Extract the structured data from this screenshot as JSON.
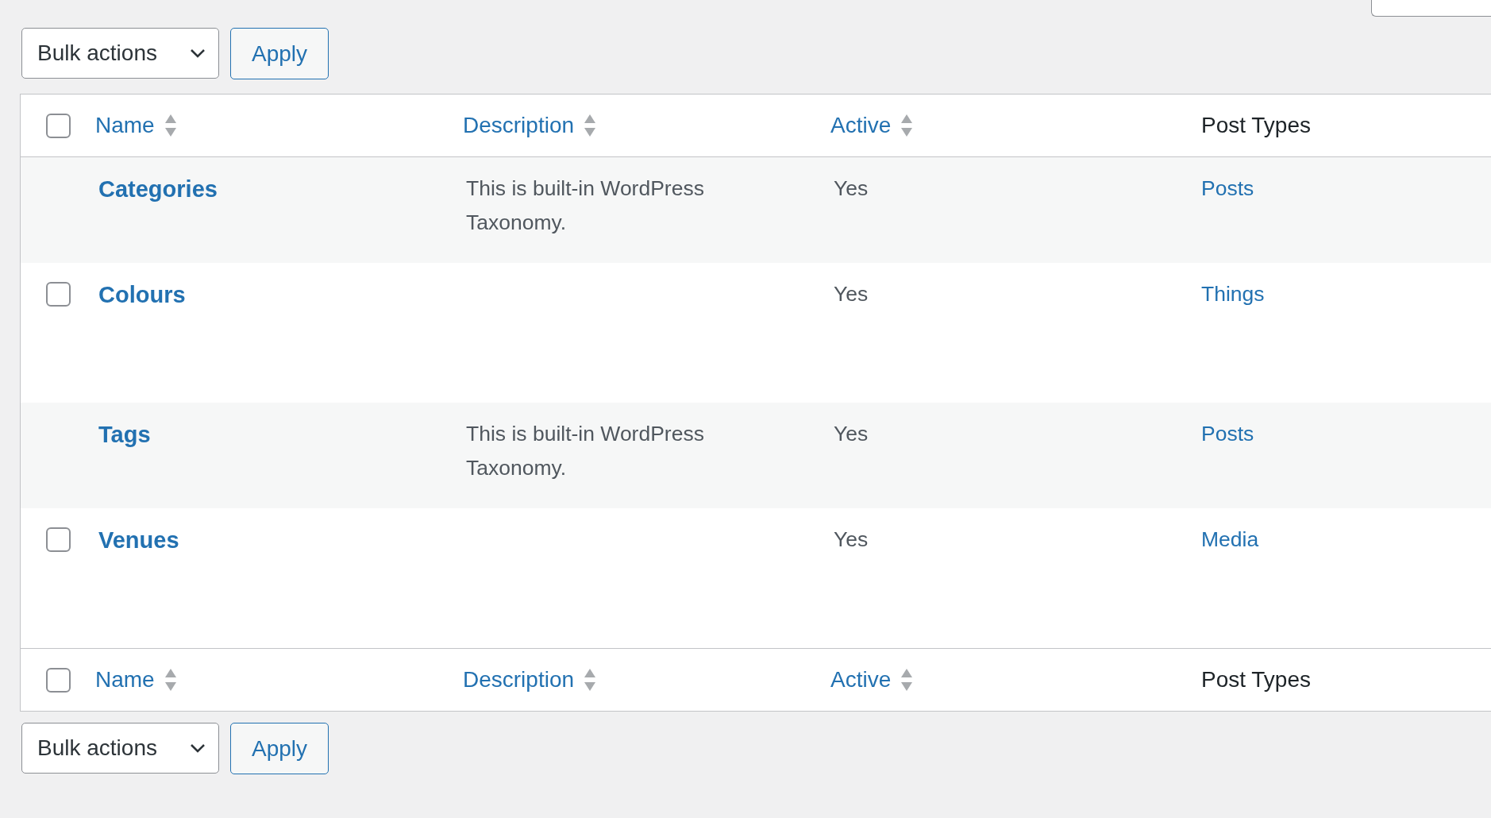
{
  "top_actions": {
    "bulk_select": "Bulk actions",
    "apply_button": "Apply"
  },
  "table": {
    "columns": [
      {
        "label": "Name",
        "sortable": true
      },
      {
        "label": "Description",
        "sortable": true
      },
      {
        "label": "Active",
        "sortable": true
      },
      {
        "label": "Post Types",
        "sortable": false
      }
    ],
    "header_checkbox": {
      "checked": false
    },
    "rows": [
      {
        "kind": "builtin",
        "name": "Categories",
        "description": "This is built-in WordPress Taxonomy.",
        "active": "Yes",
        "post_types": "Posts"
      },
      {
        "kind": "custom",
        "checked": false,
        "name": "Colours",
        "active": "Yes",
        "post_types": "Things"
      },
      {
        "kind": "builtin",
        "name": "Tags",
        "description": "This is built-in WordPress Taxonomy.",
        "active": "Yes",
        "post_types": "Posts"
      },
      {
        "kind": "custom",
        "checked": false,
        "name": "Venues",
        "active": "Yes",
        "post_types": "Media"
      }
    ],
    "footer_columns": [
      {
        "label": "Name",
        "sortable": true
      },
      {
        "label": "Description",
        "sortable": true
      },
      {
        "label": "Active",
        "sortable": true
      },
      {
        "label": "Post Types",
        "sortable": false
      }
    ],
    "footer_checkbox": {
      "checked": false
    }
  },
  "bottom_actions": {
    "bulk_select": "Bulk actions",
    "apply_button": "Apply"
  }
}
